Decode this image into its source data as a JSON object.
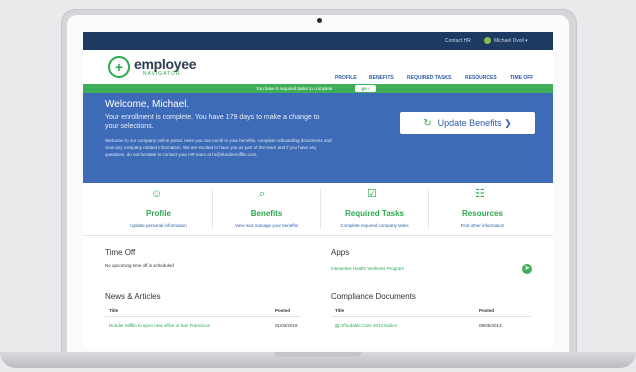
{
  "topbar": {
    "contact_hr": "Contact HR",
    "user_name": "Michael Dvoll ▾"
  },
  "header": {
    "logo_word": "employee",
    "logo_sub": "NAVIGATOR",
    "nav": [
      "PROFILE",
      "BENEFITS",
      "REQUIRED TASKS",
      "RESOURCES",
      "TIME OFF"
    ]
  },
  "alert": {
    "message": "You have 5 required tasks to complete",
    "button": "go ›"
  },
  "hero": {
    "welcome": "Welcome, Michael.",
    "enrollment": "Your enrollment is complete. You have 179 days to make a change to your selections.",
    "intro": "Welcome to our company online portal. Here you can enroll in your benefits, complete onboarding documents and view any company related information. We are excited to have you as part of the team and if you have any questions, do not hesitate to contact your HR team at hr@dundermifflin.com.",
    "update_button": "Update Benefits ❯"
  },
  "tiles": [
    {
      "icon": "person-icon",
      "glyph": "☺",
      "title": "Profile",
      "subtitle": "Update personal information"
    },
    {
      "icon": "benefits-search-icon",
      "glyph": "⌕",
      "title": "Benefits",
      "subtitle": "View and manage your benefits"
    },
    {
      "icon": "checkbox-icon",
      "glyph": "☑",
      "title": "Required Tasks",
      "subtitle": "Complete required company tasks"
    },
    {
      "icon": "document-icon",
      "glyph": "☷",
      "title": "Resources",
      "subtitle": "Find other information"
    }
  ],
  "time_off": {
    "title": "Time Off",
    "empty": "No upcoming time off is scheduled"
  },
  "apps": {
    "title": "Apps",
    "items": [
      "Interactive Health Wellness Program"
    ]
  },
  "news": {
    "title": "News & Articles",
    "col_title": "Title",
    "col_posted": "Posted",
    "rows": [
      {
        "title": "Dunder Mifflin to open new office in San Francisco!",
        "posted": "01/03/2019"
      }
    ]
  },
  "compliance": {
    "title": "Compliance Documents",
    "col_title": "Title",
    "col_posted": "Posted",
    "rows": [
      {
        "title": "Affordable Care 2013 Notice",
        "posted": "09/05/2013"
      }
    ]
  },
  "colors": {
    "navy": "#1d3a63",
    "brand_green": "#2fa84f",
    "hero_blue": "#3e6bb7",
    "link_blue": "#2c5ea8"
  }
}
